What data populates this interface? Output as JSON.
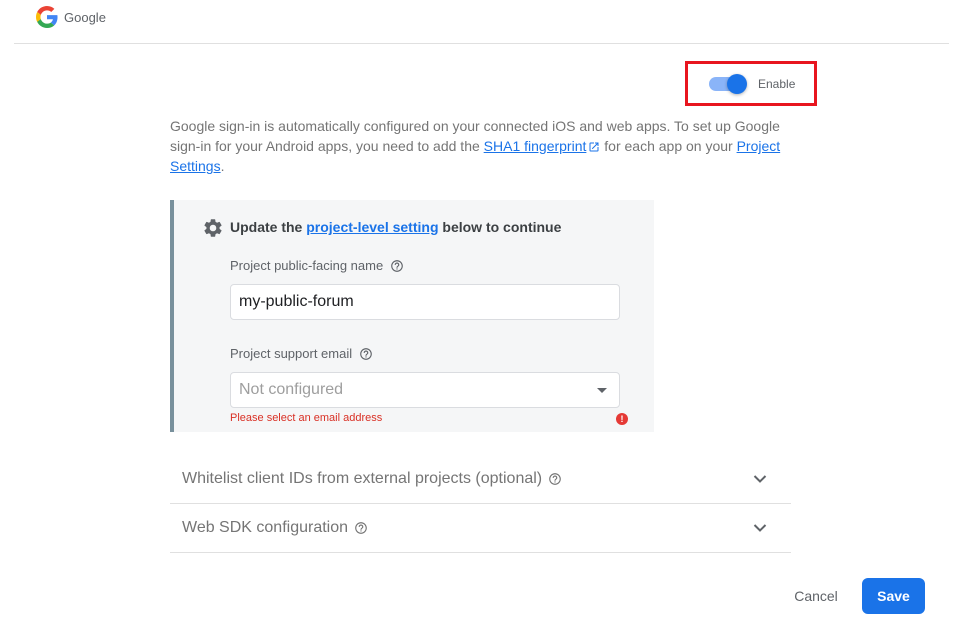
{
  "header": {
    "provider_name": "Google"
  },
  "toggle": {
    "label": "Enable",
    "state": "on"
  },
  "description": {
    "text_1": "Google sign-in is automatically configured on your connected iOS and web apps. To set up Google sign-in for your Android apps, you need to add the ",
    "link_sha1": "SHA1 fingerprint",
    "text_2": " for each app on your ",
    "link_project_settings": "Project Settings",
    "text_3": "."
  },
  "panel": {
    "heading_prefix": "Update the ",
    "heading_link": "project-level setting",
    "heading_suffix": " below to continue",
    "public_name_label": "Project public-facing name",
    "public_name_value": "my-public-forum",
    "support_email_label": "Project support email",
    "support_email_placeholder": "Not configured",
    "error_text": "Please select an email address",
    "error_icon": "!"
  },
  "sections": [
    {
      "label": "Whitelist client IDs from external projects (optional)"
    },
    {
      "label": "Web SDK configuration"
    }
  ],
  "actions": {
    "cancel_label": "Cancel",
    "save_label": "Save"
  },
  "colors": {
    "accent": "#1a73e8",
    "error": "#d93025",
    "highlight_border": "#e8151f"
  }
}
